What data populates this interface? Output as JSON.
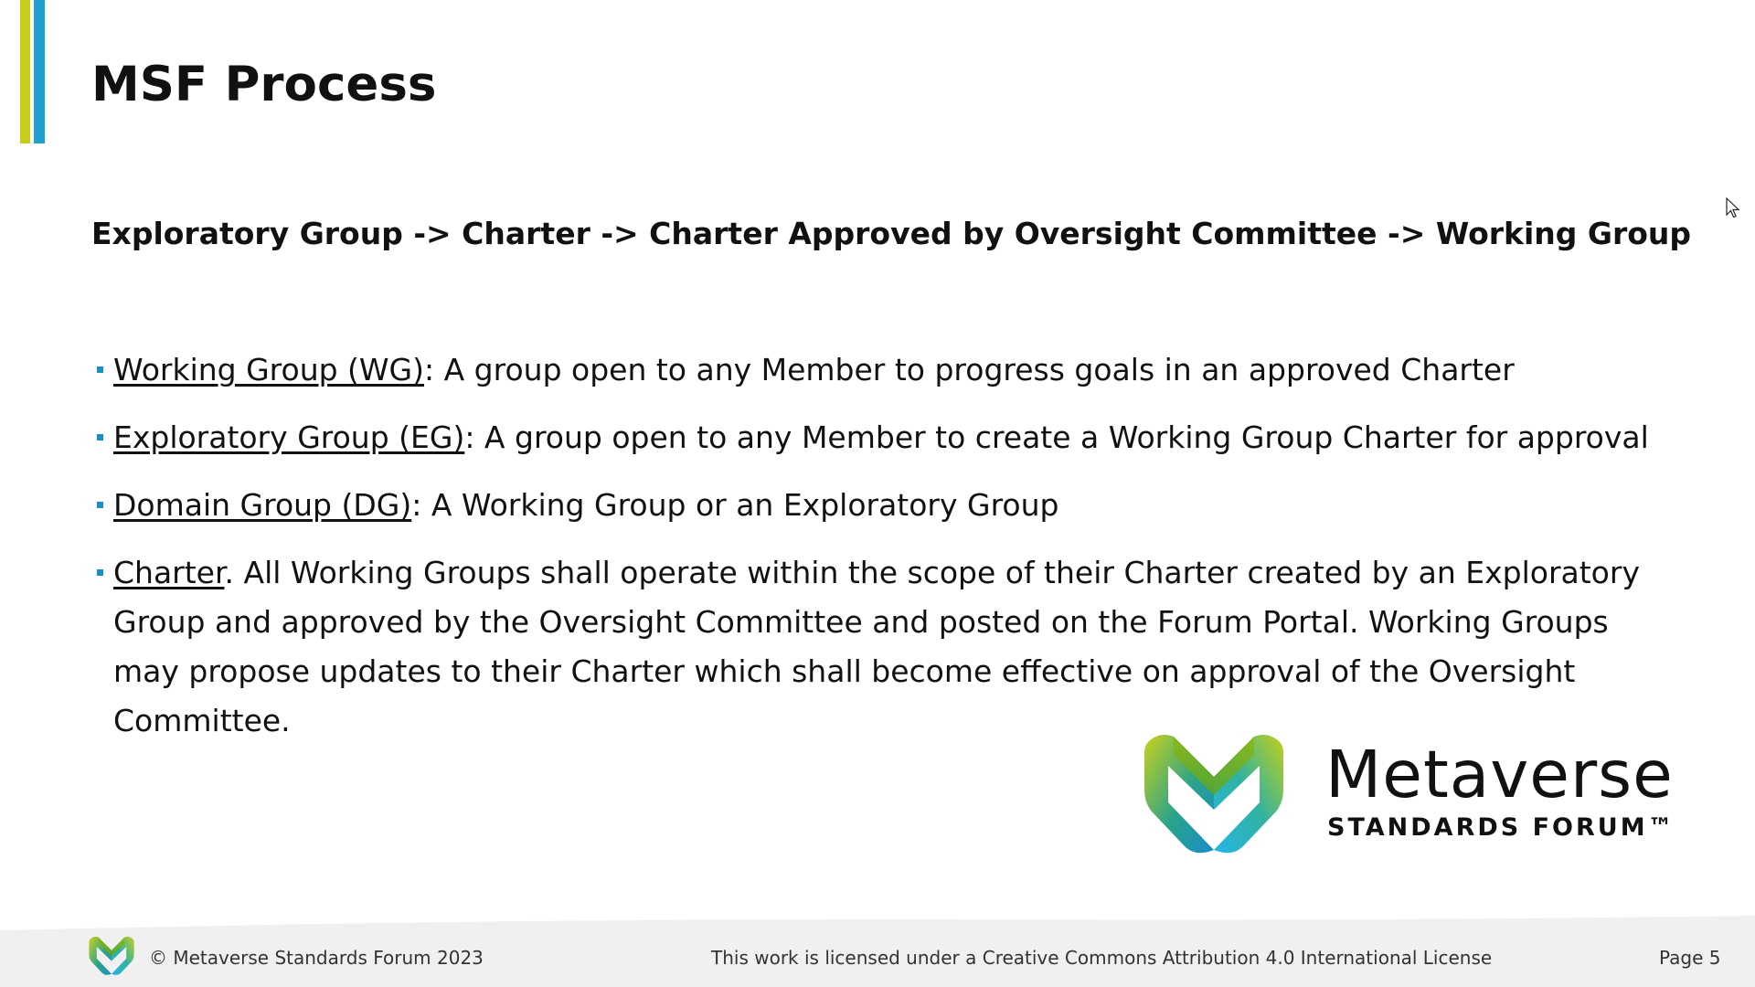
{
  "slide": {
    "title": "MSF Process",
    "process_line": "Exploratory Group -> Charter -> Charter Approved by Oversight Committee -> Working Group",
    "bullets": [
      {
        "term": "Working Group (WG)",
        "text": ": A group open to any Member to progress goals in an approved Charter"
      },
      {
        "term": "Exploratory Group (EG)",
        "text": ": A group open to any Member to create a Working Group Charter for approval"
      },
      {
        "term": "Domain Group (DG)",
        "text": ": A Working Group or an Exploratory Group"
      },
      {
        "term": "Charter",
        "text": ". All Working Groups shall operate within the scope of their Charter created by an Exploratory Group and approved by the Oversight Committee and posted on the Forum Portal. Working Groups may propose updates to their Charter which shall become effective on approval of the Oversight Committee."
      }
    ]
  },
  "logo": {
    "wordmark": "Metaverse",
    "subtitle": "STANDARDS FORUM™",
    "icon": "msf-heart-logo-icon"
  },
  "footer": {
    "copyright": "© Metaverse Standards Forum 2023",
    "license": "This work is licensed under a Creative Commons Attribution 4.0 International License",
    "page": "Page 5"
  },
  "colors": {
    "accent_yellow": "#c8cc1a",
    "accent_blue": "#1ea0d0",
    "bullet": "#1a8fc6"
  }
}
